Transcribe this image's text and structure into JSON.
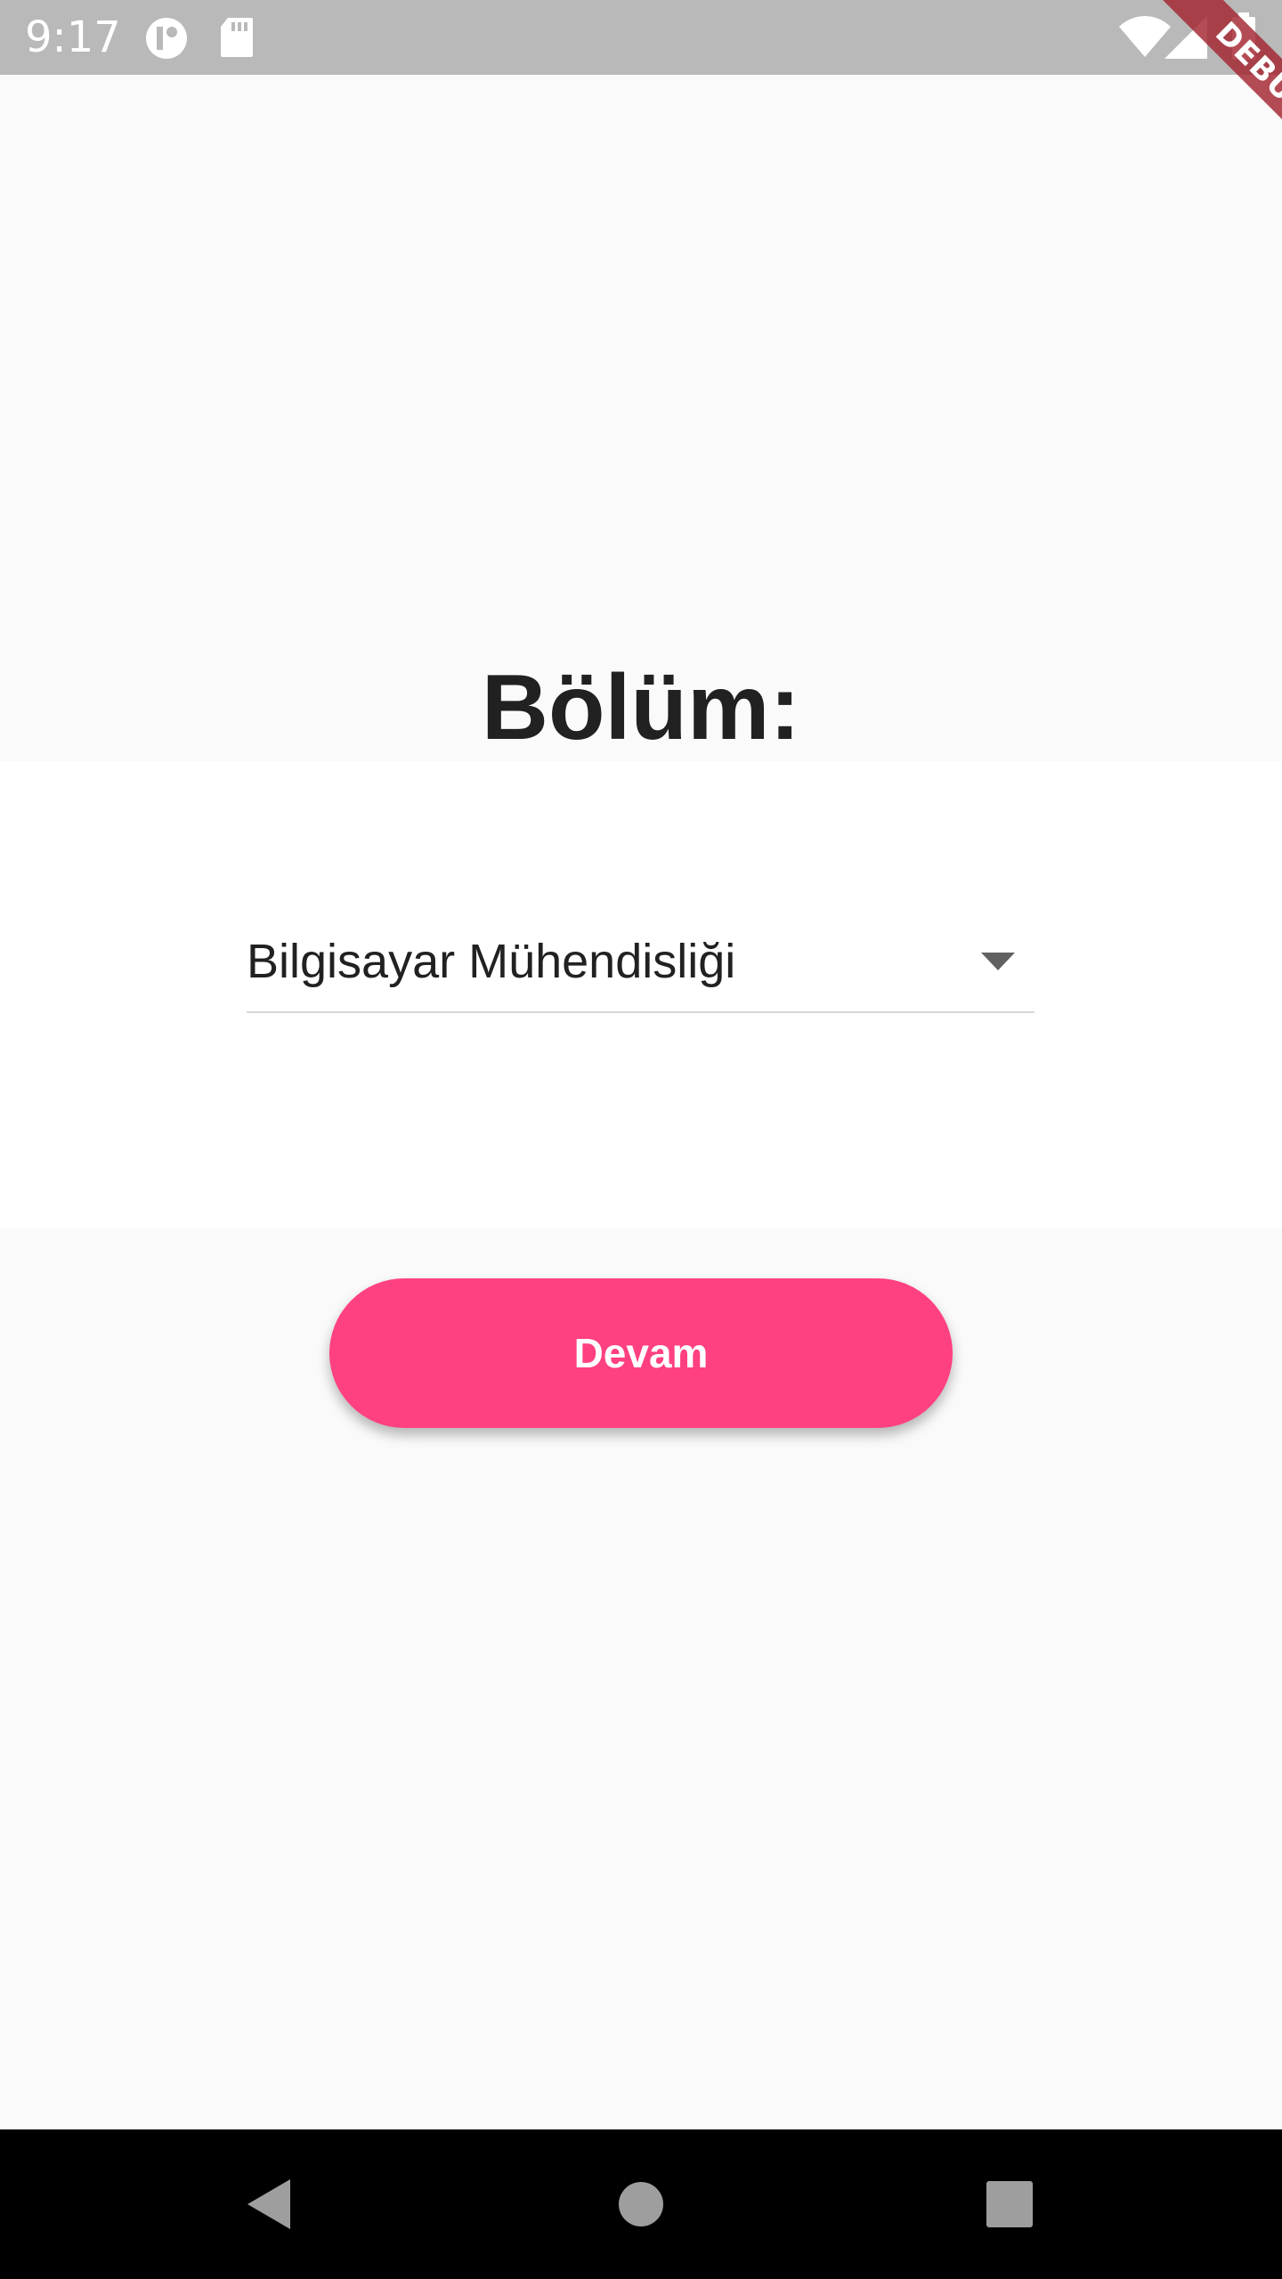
{
  "status_bar": {
    "time": "9:17",
    "icons": [
      "data-saver-icon",
      "sd-card-icon",
      "wifi-icon",
      "signal-icon",
      "battery-icon"
    ]
  },
  "debug_banner": {
    "label": "DEBUG",
    "color": "#a32430"
  },
  "main": {
    "title": "Bölüm:",
    "department_select": {
      "selected_value": "Bilgisayar Mühendisliği"
    },
    "continue_button": {
      "label": "Devam",
      "color": "#ff4081"
    }
  },
  "nav_bar": {
    "buttons": [
      "back-icon",
      "home-icon",
      "recents-icon"
    ]
  }
}
